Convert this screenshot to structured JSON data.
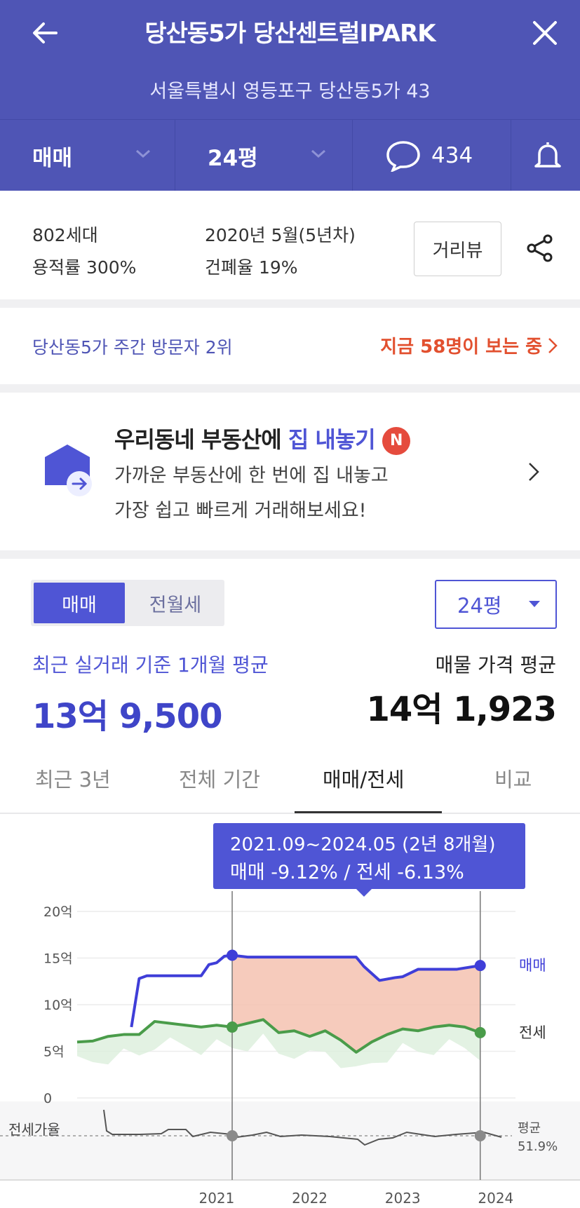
{
  "header": {
    "title": "당산동5가 당산센트럴IPARK",
    "address": "서울특별시 영등포구 당산동5가 43",
    "trade_type": "매매",
    "size": "24평",
    "comments": "434"
  },
  "info": {
    "households": "802세대",
    "built": "2020년 5월(5년차)",
    "far": "용적률 300%",
    "bcr": "건폐율 19%",
    "street_view": "거리뷰"
  },
  "visitors": {
    "rank": "당산동5가 주간 방문자 2위",
    "now": "지금 58명이 보는 중"
  },
  "promo": {
    "title_pre": "우리동네 부동산에",
    "title_hl": "집 내놓기",
    "badge": "N",
    "line1": "가까운 부동산에 한 번에 집 내놓고",
    "line2": "가장 쉽고 빠르게 거래해보세요!"
  },
  "price": {
    "toggle_on": "매매",
    "toggle_off": "전월세",
    "size_select": "24평",
    "recent_label": "최근 실거래 기준 1개월 평균",
    "recent_value": "13억 9,500",
    "listing_label": "매물 가격 평균",
    "listing_value": "14억 1,923"
  },
  "tabs": [
    "최근 3년",
    "전체 기간",
    "매매/전세",
    "비교"
  ],
  "tooltip": {
    "line1": "2021.09~2024.05 (2년 8개월)",
    "line2": "매매 -9.12%  /  전세 -6.13%"
  },
  "colors": {
    "header": "#4f55b5",
    "accent": "#4f55d5",
    "sale": "#3f3ed8",
    "jeonse": "#4a9c4a",
    "highlight": "#f4c2b0"
  },
  "chart_data": {
    "type": "line",
    "unit": "억",
    "ylim": [
      0,
      20
    ],
    "yticks": [
      "20억",
      "15억",
      "10억",
      "5억",
      "0"
    ],
    "xticks": [
      "2021",
      "2022",
      "2023",
      "2024"
    ],
    "highlight_range": [
      "2021.09",
      "2024.05"
    ],
    "series": [
      {
        "name": "매매",
        "x": [
          "2020.08",
          "2020.09",
          "2020.10",
          "2020.12",
          "2021.02",
          "2021.04",
          "2021.05",
          "2021.06",
          "2021.07",
          "2021.08",
          "2021.09",
          "2021.11",
          "2022.03",
          "2022.07",
          "2022.10",
          "2023.01",
          "2023.02",
          "2023.04",
          "2023.06",
          "2023.07",
          "2023.09",
          "2023.11",
          "2024.02",
          "2024.05"
        ],
        "values": [
          7.6,
          12.8,
          13.1,
          13.1,
          13.1,
          13.1,
          13.1,
          14.3,
          14.5,
          15.2,
          15.3,
          15.1,
          15.1,
          15.1,
          15.1,
          15.1,
          14.1,
          12.6,
          12.9,
          13.0,
          13.8,
          13.8,
          13.8,
          14.2
        ]
      },
      {
        "name": "전세",
        "x": [
          "2020.01",
          "2020.03",
          "2020.05",
          "2020.07",
          "2020.09",
          "2020.11",
          "2021.01",
          "2021.03",
          "2021.05",
          "2021.07",
          "2021.09",
          "2021.11",
          "2022.01",
          "2022.03",
          "2022.05",
          "2022.07",
          "2022.09",
          "2022.11",
          "2023.01",
          "2023.03",
          "2023.05",
          "2023.07",
          "2023.09",
          "2023.11",
          "2024.01",
          "2024.03",
          "2024.05"
        ],
        "values": [
          6.0,
          6.1,
          6.6,
          6.8,
          6.8,
          8.2,
          8.0,
          7.8,
          7.6,
          7.8,
          7.6,
          8.0,
          8.4,
          7.0,
          7.2,
          6.6,
          7.2,
          6.2,
          4.9,
          6.0,
          6.8,
          7.4,
          7.2,
          7.6,
          7.8,
          7.6,
          7.0
        ]
      }
    ],
    "ratio": {
      "label": "전세가율",
      "avg_label": "평균",
      "avg_value": "51.9%"
    },
    "end_labels": [
      "매매",
      "전세"
    ]
  }
}
